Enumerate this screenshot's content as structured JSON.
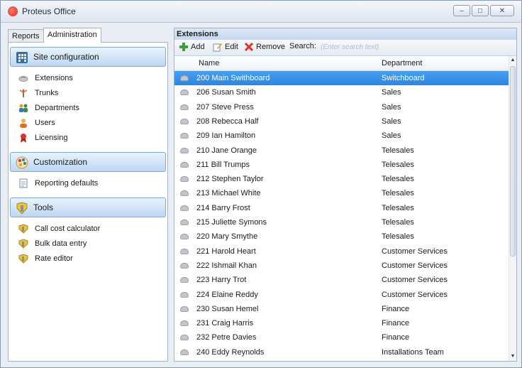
{
  "window": {
    "title": "Proteus Office",
    "minimize_glyph": "–",
    "maximize_glyph": "□",
    "close_glyph": "✕"
  },
  "left_tabs": [
    {
      "label": "Reports",
      "active": false
    },
    {
      "label": "Administration",
      "active": true
    }
  ],
  "sections": {
    "site_configuration": {
      "label": "Site configuration",
      "icon": "building-icon",
      "items": [
        {
          "label": "Extensions",
          "icon": "phone-icon"
        },
        {
          "label": "Trunks",
          "icon": "antenna-icon"
        },
        {
          "label": "Departments",
          "icon": "group-icon"
        },
        {
          "label": "Users",
          "icon": "user-icon"
        },
        {
          "label": "Licensing",
          "icon": "ribbon-icon"
        }
      ]
    },
    "customization": {
      "label": "Customization",
      "icon": "palette-icon",
      "items": [
        {
          "label": "Reporting defaults",
          "icon": "document-icon"
        }
      ]
    },
    "tools": {
      "label": "Tools",
      "icon": "tools-icon",
      "items": [
        {
          "label": "Call cost calculator",
          "icon": "tool-icon"
        },
        {
          "label": "Bulk data entry",
          "icon": "tool-icon"
        },
        {
          "label": "Rate editor",
          "icon": "tool-icon"
        }
      ]
    }
  },
  "extensions_panel": {
    "header": "Extensions",
    "toolbar": {
      "add_label": "Add",
      "edit_label": "Edit",
      "remove_label": "Remove",
      "search_label": "Search:",
      "search_placeholder": "(Enter search text)"
    },
    "columns": {
      "name": "Name",
      "department": "Department"
    },
    "rows": [
      {
        "name": "200  Main Swithboard",
        "department": "Switchboard",
        "selected": true
      },
      {
        "name": "206  Susan Smith",
        "department": "Sales"
      },
      {
        "name": "207  Steve Press",
        "department": "Sales"
      },
      {
        "name": "208  Rebecca Half",
        "department": "Sales"
      },
      {
        "name": "209  Ian Hamilton",
        "department": "Sales"
      },
      {
        "name": "210  Jane Orange",
        "department": "Telesales"
      },
      {
        "name": "211  Bill Trumps",
        "department": "Telesales"
      },
      {
        "name": "212  Stephen Taylor",
        "department": "Telesales"
      },
      {
        "name": "213  Michael White",
        "department": "Telesales"
      },
      {
        "name": "214  Barry Frost",
        "department": "Telesales"
      },
      {
        "name": "215  Juliette Symons",
        "department": "Telesales"
      },
      {
        "name": "220  Mary Smythe",
        "department": "Telesales"
      },
      {
        "name": "221  Harold Heart",
        "department": "Customer Services"
      },
      {
        "name": "222  Ishmail Khan",
        "department": "Customer Services"
      },
      {
        "name": "223  Harry Trot",
        "department": "Customer Services"
      },
      {
        "name": "224  Elaine Reddy",
        "department": "Customer Services"
      },
      {
        "name": "230  Susan Hemel",
        "department": "Finance"
      },
      {
        "name": "231  Craig Harris",
        "department": "Finance"
      },
      {
        "name": "232  Petre Davies",
        "department": "Finance"
      },
      {
        "name": "240  Eddy Reynolds",
        "department": "Installations Team"
      }
    ]
  },
  "colors": {
    "selection": "#2a86e2",
    "section_header": "#bcd7f3",
    "add_icon": "#3aa13a",
    "remove_icon": "#d9342b"
  }
}
